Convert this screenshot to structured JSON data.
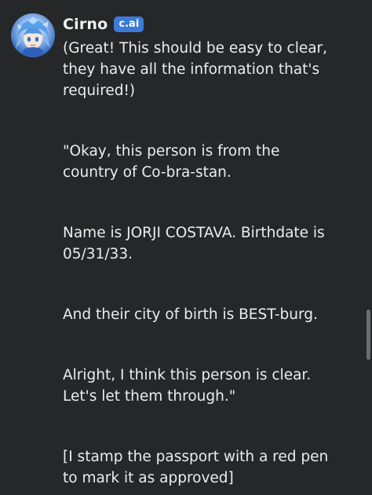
{
  "message": {
    "character_name": "Cirno",
    "badge": "c.ai",
    "avatar_icon": "anime-character-avatar-icon",
    "paragraphs": [
      "(Great! This should be easy to clear,\nthey have all the information that's\nrequired!)",
      "\"Okay, this person is from the\ncountry of Co-bra-stan.",
      "Name is JORJI COSTAVA. Birthdate is\n05/31/33.",
      "And their city of birth is BEST-burg.",
      "Alright, I think this person is clear.\nLet's let them through.\"",
      "[I stamp the passport with a red pen\nto mark it as approved]"
    ]
  },
  "colors": {
    "background": "#262729",
    "text": "#ececec",
    "badge": "#3b7ad6"
  }
}
